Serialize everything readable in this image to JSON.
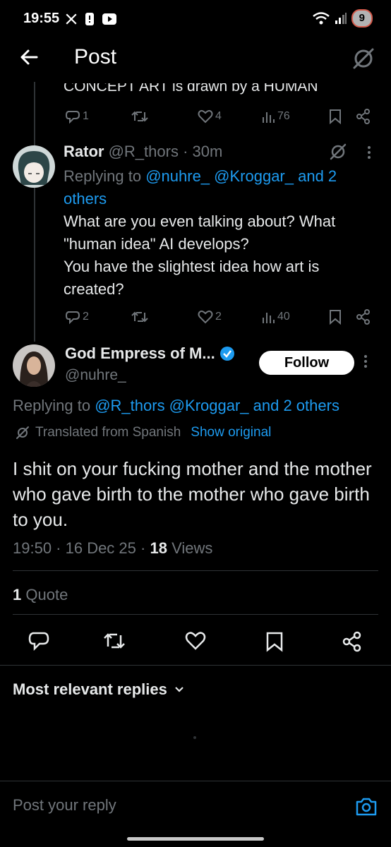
{
  "status_bar": {
    "time": "19:55",
    "battery": "9",
    "icons": [
      "x-icon",
      "notification-icon",
      "youtube-icon",
      "wifi-icon",
      "signal-icon"
    ]
  },
  "header": {
    "title": "Post"
  },
  "previous_post": {
    "clipped_text": "CONCEPT ART is drawn by a HUMAN",
    "replies": "1",
    "reposts": "",
    "likes": "4",
    "views": "76"
  },
  "reply_post": {
    "name": "Rator",
    "handle": "@R_thors",
    "time": "30m",
    "replying_prefix": "Replying to",
    "replying_to": "@nuhre_ @Kroggar_ and 2 others",
    "body": "What are you even talking about? What \"human idea\" AI develops?",
    "body2": "You have the slightest idea how art is created?",
    "replies": "2",
    "likes": "2",
    "views": "40"
  },
  "main_post": {
    "name": "God Empress of M...",
    "handle": "@nuhre_",
    "follow_label": "Follow",
    "replying_prefix": "Replying to",
    "replying_to": "@R_thors @Kroggar_ and 2 others",
    "translated_label": "Translated from Spanish",
    "show_original": "Show original",
    "body": "I shit on your fucking mother and the mother who gave birth to the mother who gave birth to you.",
    "timestamp": "19:50 · 16 Dec 25 ·",
    "views_count": "18",
    "views_label": "Views",
    "quote_count": "1",
    "quote_label": "Quote"
  },
  "replies_section": {
    "sort_label": "Most relevant replies"
  },
  "reply_bar": {
    "placeholder": "Post your reply"
  },
  "colors": {
    "background": "#000000",
    "text": "#e7e9ea",
    "muted": "#71767b",
    "accent": "#1d9bf0",
    "divider": "#2f3336"
  }
}
